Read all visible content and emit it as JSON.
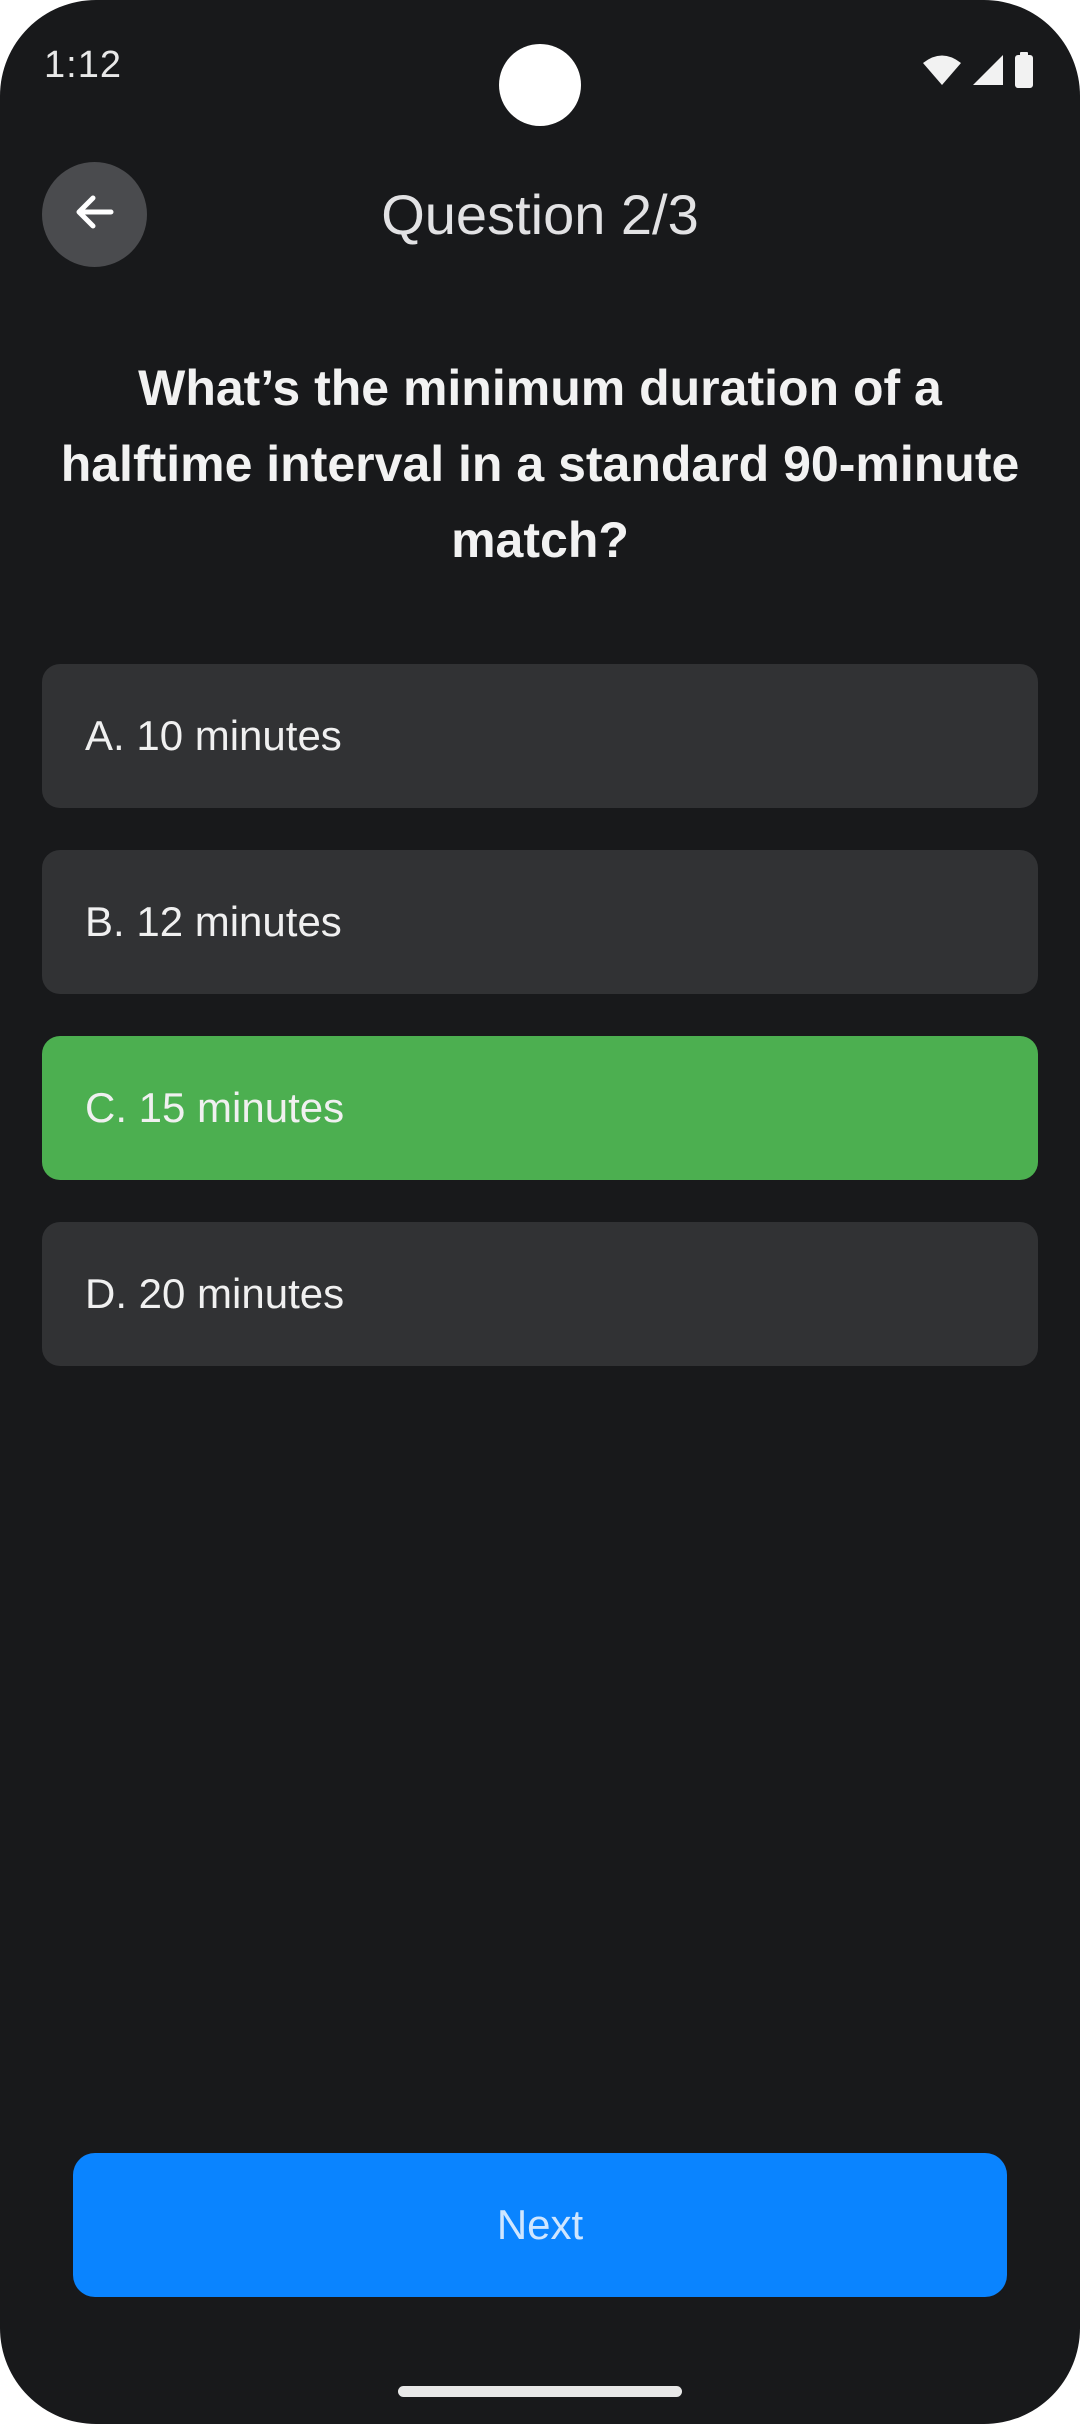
{
  "status_bar": {
    "time": "1:12",
    "icons": [
      "wifi-icon",
      "cellular-signal-icon",
      "battery-icon"
    ]
  },
  "header": {
    "back_icon": "arrow-left-icon",
    "title": "Question 2/3"
  },
  "question": {
    "text": "What’s the minimum duration of a halftime interval in a standard 90-minute match?"
  },
  "options": [
    {
      "label": "A. 10 minutes",
      "selected": false
    },
    {
      "label": "B. 12 minutes",
      "selected": false
    },
    {
      "label": "C. 15 minutes",
      "selected": true
    },
    {
      "label": "D. 20 minutes",
      "selected": false
    }
  ],
  "actions": {
    "next_label": "Next"
  },
  "colors": {
    "background": "#18191b",
    "option_default": "#313234",
    "option_selected": "#4caf50",
    "primary_button": "#0a84ff"
  }
}
